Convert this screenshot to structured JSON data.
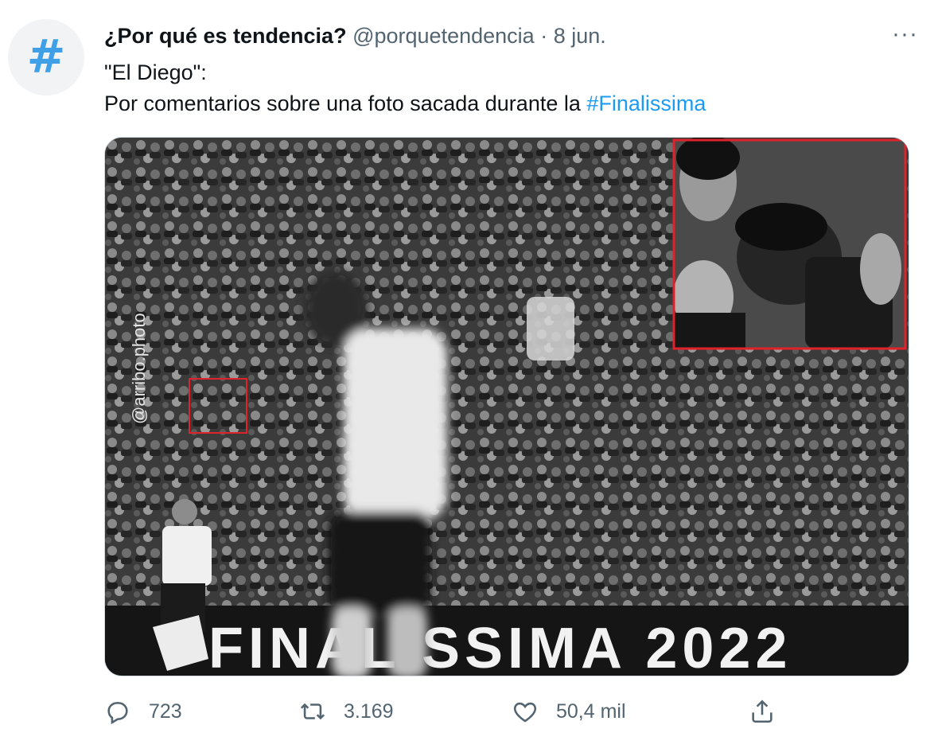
{
  "tweet": {
    "display_name": "¿Por qué es tendencia?",
    "handle": "@porquetendencia",
    "separator": "·",
    "date": "8 jun.",
    "more_label": "···",
    "avatar_glyph": "#",
    "text_line1": "\"El Diego\":",
    "text_line2": "Por comentarios sobre una foto sacada durante la ",
    "hashtag": "#Finalissima",
    "media": {
      "watermark": "@arribo.photo",
      "banner_text": "FINALISSIMA 2022",
      "highlight_color": "#e0222b"
    }
  },
  "actions": {
    "reply": {
      "icon": "reply-icon",
      "count": "723"
    },
    "retweet": {
      "icon": "retweet-icon",
      "count": "3.169"
    },
    "like": {
      "icon": "heart-icon",
      "count": "50,4 mil"
    },
    "share": {
      "icon": "share-icon"
    }
  },
  "colors": {
    "link": "#1d9bf0",
    "muted": "#536471",
    "avatar_glyph": "#3fa0e8"
  }
}
